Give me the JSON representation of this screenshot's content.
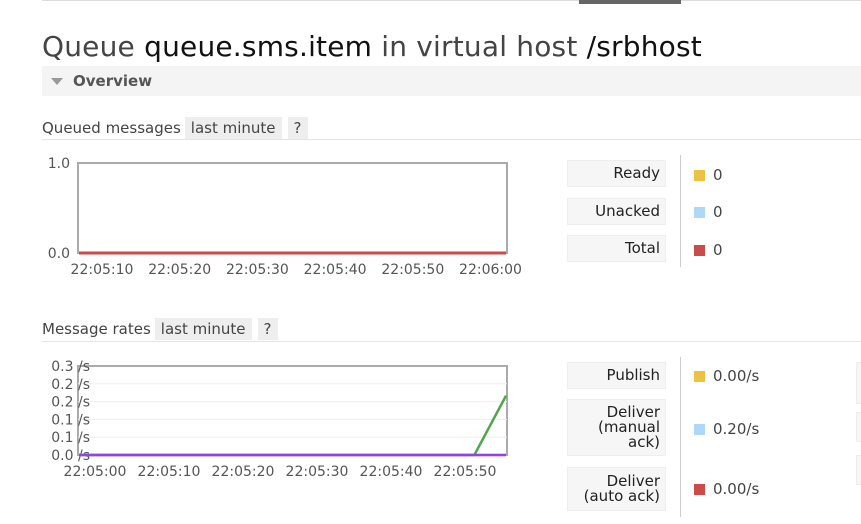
{
  "title": {
    "prefix": "Queue ",
    "queue": "queue.sms.item",
    "middle": " in virtual host ",
    "vhost": "/srbhost"
  },
  "overview": {
    "label": "Overview"
  },
  "queued": {
    "label": "Queued messages",
    "range": "last minute",
    "help": "?",
    "chart_data": {
      "type": "line",
      "ylim": [
        0,
        1.0
      ],
      "yticks": [
        "1.0",
        "0.0"
      ],
      "xticks": [
        "22:05:10",
        "22:05:20",
        "22:05:30",
        "22:05:40",
        "22:05:50",
        "22:06:00"
      ],
      "series": [
        {
          "name": "Ready",
          "color": "#edc240",
          "values": [
            0,
            0
          ]
        },
        {
          "name": "Unacked",
          "color": "#afd8f8",
          "values": [
            0,
            0
          ]
        },
        {
          "name": "Total",
          "color": "#cb4b4b",
          "values": [
            0,
            0
          ]
        }
      ]
    },
    "legend": [
      {
        "label": "Ready",
        "value": "0",
        "color": "#edc240"
      },
      {
        "label": "Unacked",
        "value": "0",
        "color": "#afd8f8"
      },
      {
        "label": "Total",
        "value": "0",
        "color": "#cb4b4b"
      }
    ]
  },
  "rates": {
    "label": "Message rates",
    "range": "last minute",
    "help": "?",
    "chart_data": {
      "type": "line",
      "ylim": [
        0,
        0.3
      ],
      "yticks": [
        "0.3 /s",
        "0.2 /s",
        "0.2 /s",
        "0.1 /s",
        "0.1 /s",
        "0.0 /s"
      ],
      "xticks": [
        "22:05:00",
        "22:05:10",
        "22:05:20",
        "22:05:30",
        "22:05:40",
        "22:05:50"
      ],
      "series": [
        {
          "name": "Publish",
          "color": "#edc240",
          "points": [
            [
              0,
              0
            ],
            [
              54,
              0
            ]
          ]
        },
        {
          "name": "Deliver (manual ack)",
          "color": "#4da74d",
          "points": [
            [
              0,
              0
            ],
            [
              50,
              0
            ],
            [
              54,
              0.2
            ]
          ]
        },
        {
          "name": "Deliver (auto ack)",
          "color": "#9440ed",
          "points": [
            [
              0,
              0
            ],
            [
              54,
              0
            ]
          ]
        }
      ]
    },
    "legend": [
      {
        "label": "Publish",
        "value": "0.00/s",
        "color": "#edc240"
      },
      {
        "label": "Deliver (manual ack)",
        "value": "0.20/s",
        "color": "#afd8f8"
      },
      {
        "label": "Deliver (auto ack)",
        "value": "0.00/s",
        "color": "#cb4b4b"
      }
    ]
  }
}
